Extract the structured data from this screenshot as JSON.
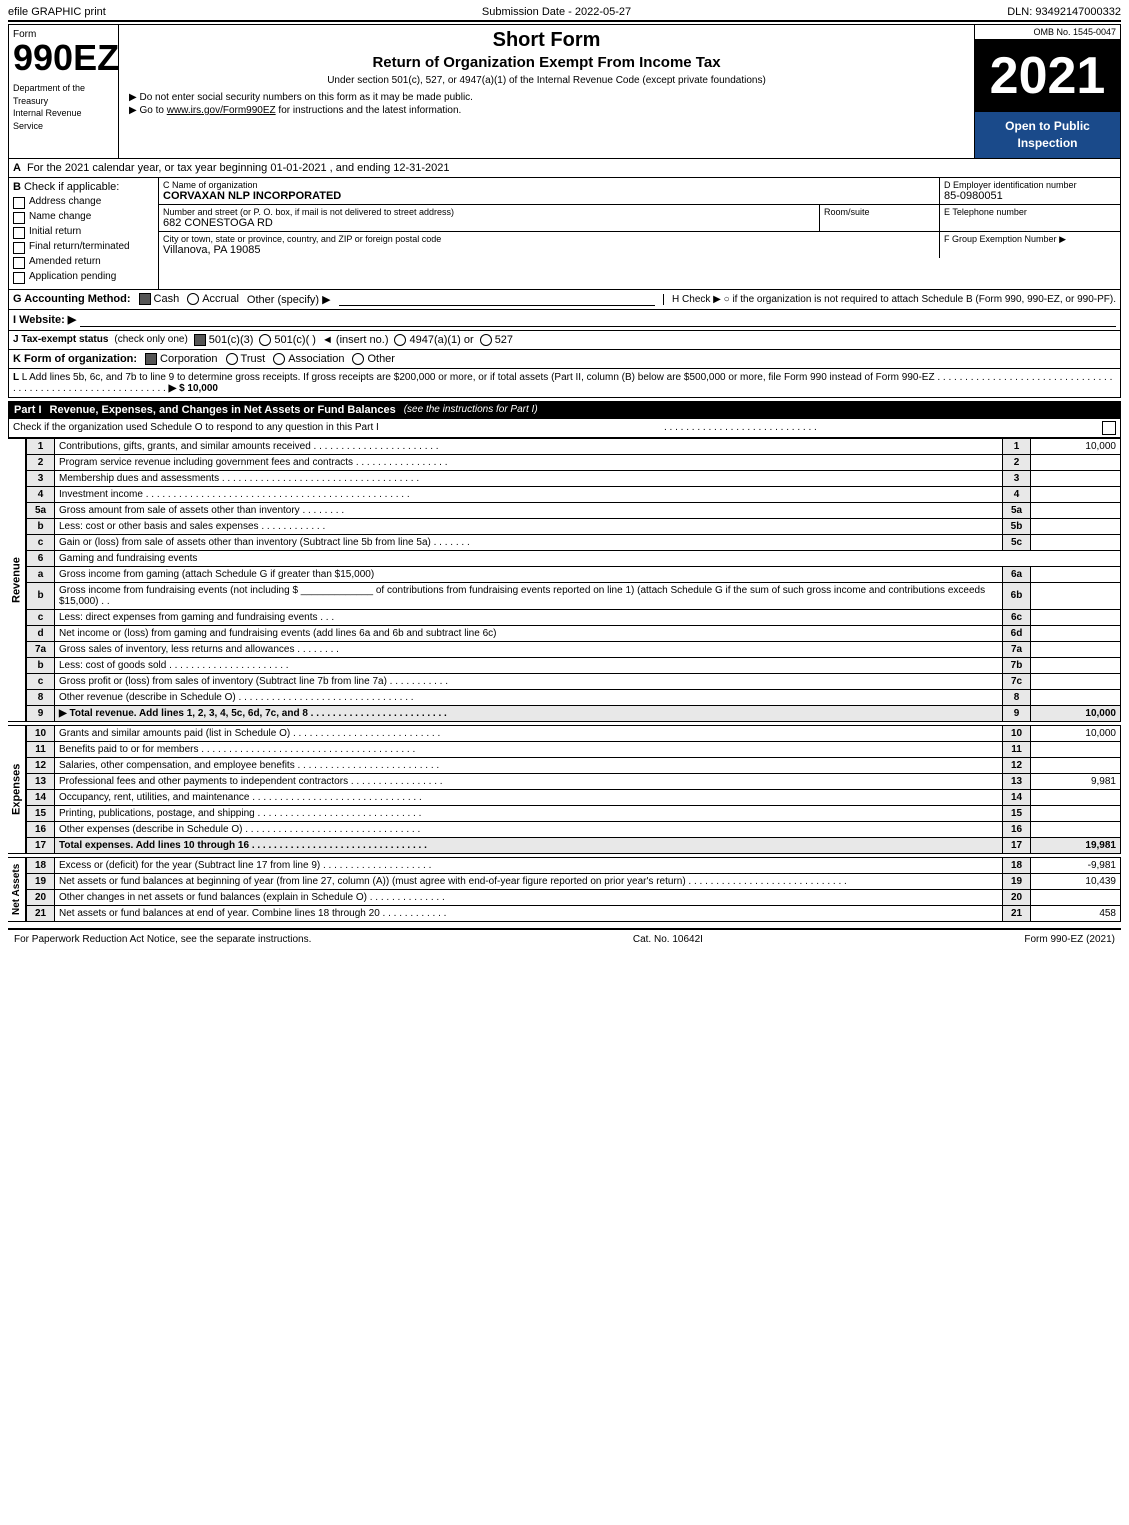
{
  "topBar": {
    "left": "efile GRAPHIC print",
    "center": "Submission Date - 2022-05-27",
    "right": "DLN: 93492147000332"
  },
  "header": {
    "omb": "OMB No. 1545-0047",
    "formNumber": "990EZ",
    "dept1": "Department of the",
    "dept2": "Treasury",
    "dept3": "Internal Revenue",
    "dept4": "Service",
    "title1": "Short Form",
    "title2": "Return of Organization Exempt From Income Tax",
    "subtitle": "Under section 501(c), 527, or 4947(a)(1) of the Internal Revenue Code (except private foundations)",
    "instruction1": "▶ Do not enter social security numbers on this form as it may be made public.",
    "instruction2": "▶ Go to www.irs.gov/Form990EZ for instructions and the latest information.",
    "year": "2021",
    "openToPublic": "Open to Public Inspection"
  },
  "sectionA": {
    "label": "A",
    "text": "For the 2021 calendar year, or tax year beginning 01-01-2021 , and ending 12-31-2021"
  },
  "sectionB": {
    "label": "B",
    "checkLabel": "Check if applicable:",
    "items": [
      {
        "id": "address-change",
        "label": "Address change",
        "checked": false
      },
      {
        "id": "name-change",
        "label": "Name change",
        "checked": false
      },
      {
        "id": "initial-return",
        "label": "Initial return",
        "checked": false
      },
      {
        "id": "final-return",
        "label": "Final return/terminated",
        "checked": false
      },
      {
        "id": "amended-return",
        "label": "Amended return",
        "checked": false
      },
      {
        "id": "application-pending",
        "label": "Application pending",
        "checked": false
      }
    ]
  },
  "orgInfo": {
    "cLabel": "C Name of organization",
    "orgName": "CORVAXAN NLP INCORPORATED",
    "addressLabel": "Number and street (or P. O. box, if mail is not delivered to street address)",
    "address": "682 CONESTOGA RD",
    "roomLabel": "Room/suite",
    "roomValue": "",
    "cityLabel": "City or town, state or province, country, and ZIP or foreign postal code",
    "cityValue": "Villanova, PA  19085",
    "dLabel": "D Employer identification number",
    "ein": "85-0980051",
    "eLabel": "E Telephone number",
    "eValue": "",
    "fLabel": "F Group Exemption Number",
    "fArrow": "▶",
    "fValue": ""
  },
  "accounting": {
    "gLabel": "G Accounting Method:",
    "cashLabel": "Cash",
    "cashChecked": true,
    "accrualLabel": "Accrual",
    "accrualChecked": false,
    "otherLabel": "Other (specify) ▶",
    "hLabel": "H Check ▶",
    "hText": "○ if the organization is not required to attach Schedule B (Form 990, 990-EZ, or 990-PF)."
  },
  "website": {
    "label": "I Website: ▶",
    "value": ""
  },
  "taxStatus": {
    "label": "J Tax-exempt status",
    "note": "(check only one)",
    "options": [
      {
        "id": "501c3",
        "label": "501(c)(3)",
        "checked": true
      },
      {
        "id": "501c",
        "label": "501(c)(  )",
        "checked": false
      },
      {
        "id": "insert",
        "label": "◄ (insert no.)",
        "checked": false
      },
      {
        "id": "4947a1",
        "label": "4947(a)(1) or",
        "checked": false
      },
      {
        "id": "527",
        "label": "527",
        "checked": false
      }
    ]
  },
  "formOfOrg": {
    "label": "K Form of organization:",
    "options": [
      {
        "id": "corporation",
        "label": "Corporation",
        "checked": true
      },
      {
        "id": "trust",
        "label": "Trust",
        "checked": false
      },
      {
        "id": "association",
        "label": "Association",
        "checked": false
      },
      {
        "id": "other",
        "label": "Other",
        "checked": false
      }
    ]
  },
  "lineL": {
    "text": "L Add lines 5b, 6c, and 7b to line 9 to determine gross receipts. If gross receipts are $200,000 or more, or if total assets (Part II, column (B) below are $500,000 or more, file Form 990 instead of Form 990-EZ",
    "dots": ". . . . . . . . . . . . . . . . . . . . . . . . . . . . . . . . . . . . . . . . . . . . . . . . . . . . . . . . . . . .",
    "arrow": "▶ $ 10,000"
  },
  "partI": {
    "label": "Part I",
    "title": "Revenue, Expenses, and Changes in Net Assets or Fund Balances",
    "subtitle": "(see the instructions for Part I)",
    "checkText": "Check if the organization used Schedule O to respond to any question in this Part I",
    "dots": ". . . . . . . . . . . . . . . . . . . . . . . . . . . .",
    "lines": [
      {
        "num": "1",
        "desc": "Contributions, gifts, grants, and similar amounts received . . . . . . . . . . . . . . . . . . . . . . .",
        "lineNum": "1",
        "value": "10,000"
      },
      {
        "num": "2",
        "desc": "Program service revenue including government fees and contracts . . . . . . . . . . . . . . . . .",
        "lineNum": "2",
        "value": ""
      },
      {
        "num": "3",
        "desc": "Membership dues and assessments . . . . . . . . . . . . . . . . . . . . . . . . . . . . . . . . . . . .",
        "lineNum": "3",
        "value": ""
      },
      {
        "num": "4",
        "desc": "Investment income . . . . . . . . . . . . . . . . . . . . . . . . . . . . . . . . . . . . . . . . . . . . . . . .",
        "lineNum": "4",
        "value": ""
      },
      {
        "num": "5a",
        "desc": "Gross amount from sale of assets other than inventory . . . . . . . .",
        "subLabel": "5a",
        "subValue": "",
        "lineNum": "",
        "value": ""
      },
      {
        "num": "b",
        "desc": "Less: cost or other basis and sales expenses . . . . . . . . . . . .",
        "subLabel": "5b",
        "subValue": "",
        "lineNum": "",
        "value": ""
      },
      {
        "num": "c",
        "desc": "Gain or (loss) from sale of assets other than inventory (Subtract line 5b from line 5a) . . . . . . .",
        "lineNum": "5c",
        "value": ""
      },
      {
        "num": "6",
        "desc": "Gaming and fundraising events",
        "lineNum": "",
        "value": ""
      },
      {
        "num": "a",
        "desc": "Gross income from gaming (attach Schedule G if greater than $15,000)",
        "subLabel": "6a",
        "subValue": "",
        "lineNum": "",
        "value": ""
      },
      {
        "num": "b",
        "desc": "Gross income from fundraising events (not including $ _____________ of contributions from fundraising events reported on line 1) (attach Schedule G if the sum of such gross income and contributions exceeds $15,000)  .  .",
        "subLabel": "6b",
        "subValue": "",
        "lineNum": "",
        "value": ""
      },
      {
        "num": "c",
        "desc": "Less: direct expenses from gaming and fundraising events   .  .  .",
        "subLabel": "6c",
        "subValue": "",
        "lineNum": "",
        "value": ""
      },
      {
        "num": "d",
        "desc": "Net income or (loss) from gaming and fundraising events (add lines 6a and 6b and subtract line 6c)",
        "lineNum": "6d",
        "value": ""
      },
      {
        "num": "7a",
        "desc": "Gross sales of inventory, less returns and allowances . . . . . . . .",
        "subLabel": "7a",
        "subValue": "",
        "lineNum": "",
        "value": ""
      },
      {
        "num": "b",
        "desc": "Less: cost of goods sold    .  .  .  .  .  .  .  .  .  .  .  .  .  .  .  .  .  .  .  .  .  .",
        "subLabel": "7b",
        "subValue": "",
        "lineNum": "",
        "value": ""
      },
      {
        "num": "c",
        "desc": "Gross profit or (loss) from sales of inventory (Subtract line 7b from line 7a)  . . . . . . . . . . .",
        "lineNum": "7c",
        "value": ""
      },
      {
        "num": "8",
        "desc": "Other revenue (describe in Schedule O) . . . . . . . . . . . . . . . . . . . . . . . . . . . . . . . .",
        "lineNum": "8",
        "value": ""
      },
      {
        "num": "9",
        "desc": "Total revenue. Add lines 1, 2, 3, 4, 5c, 6d, 7c, and 8  . . . . . . . . . . . . . . . . . . . . . . . . .",
        "lineNum": "9",
        "value": "10,000",
        "bold": true,
        "arrow": "▶"
      }
    ]
  },
  "partIExpenses": {
    "lines": [
      {
        "num": "10",
        "desc": "Grants and similar amounts paid (list in Schedule O) . . . . . . . . . . . . . . . . . . . . . . . . . . .",
        "lineNum": "10",
        "value": "10,000"
      },
      {
        "num": "11",
        "desc": "Benefits paid to or for members  . . . . . . . . . . . . . . . . . . . . . . . . . . . . . . . . . . . . . . .",
        "lineNum": "11",
        "value": ""
      },
      {
        "num": "12",
        "desc": "Salaries, other compensation, and employee benefits . . . . . . . . . . . . . . . . . . . . . . . . . .",
        "lineNum": "12",
        "value": ""
      },
      {
        "num": "13",
        "desc": "Professional fees and other payments to independent contractors . . . . . . . . . . . . . . . . .",
        "lineNum": "13",
        "value": "9,981"
      },
      {
        "num": "14",
        "desc": "Occupancy, rent, utilities, and maintenance . . . . . . . . . . . . . . . . . . . . . . . . . . . . . . .",
        "lineNum": "14",
        "value": ""
      },
      {
        "num": "15",
        "desc": "Printing, publications, postage, and shipping . . . . . . . . . . . . . . . . . . . . . . . . . . . . . .",
        "lineNum": "15",
        "value": ""
      },
      {
        "num": "16",
        "desc": "Other expenses (describe in Schedule O) . . . . . . . . . . . . . . . . . . . . . . . . . . . . . . . .",
        "lineNum": "16",
        "value": ""
      },
      {
        "num": "17",
        "desc": "Total expenses. Add lines 10 through 16   . . . . . . . . . . . . . . . . . . . . . . . . . . . . . . . .",
        "lineNum": "17",
        "value": "19,981",
        "bold": true,
        "arrow": "▶"
      }
    ]
  },
  "partINetAssets": {
    "lines": [
      {
        "num": "18",
        "desc": "Excess or (deficit) for the year (Subtract line 17 from line 9)   . . . . . . . . . . . . . . . . . . . .",
        "lineNum": "18",
        "value": "-9,981"
      },
      {
        "num": "19",
        "desc": "Net assets or fund balances at beginning of year (from line 27, column (A)) (must agree with end-of-year figure reported on prior year's return) . . . . . . . . . . . . . . . . . . . . . . . . . . . . .",
        "lineNum": "19",
        "value": "10,439"
      },
      {
        "num": "20",
        "desc": "Other changes in net assets or fund balances (explain in Schedule O) . . . . . . . . . . . . . .",
        "lineNum": "20",
        "value": ""
      },
      {
        "num": "21",
        "desc": "Net assets or fund balances at end of year. Combine lines 18 through 20 . . . . . . . . . . . .",
        "lineNum": "21",
        "value": "458"
      }
    ]
  },
  "footer": {
    "left": "For Paperwork Reduction Act Notice, see the separate instructions.",
    "center": "Cat. No. 10642I",
    "right": "Form 990-EZ (2021)"
  }
}
